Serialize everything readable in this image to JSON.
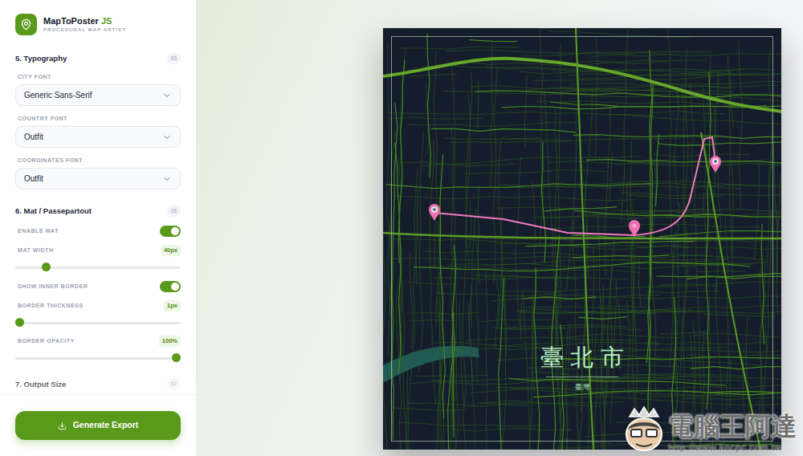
{
  "app": {
    "name": "MapToPoster",
    "accent": "JS",
    "subtitle": "PROCEDURAL MAP ARTIST"
  },
  "sections": [
    {
      "title": "5. Typography",
      "number": "05",
      "controls": [
        {
          "kind": "select",
          "label": "CITY FONT",
          "value": "Generic Sans-Serif"
        },
        {
          "kind": "select",
          "label": "COUNTRY FONT",
          "value": "Outfit"
        },
        {
          "kind": "select",
          "label": "COORDINATES FONT",
          "value": "Outfit"
        }
      ]
    },
    {
      "title": "6. Mat / Passepartout",
      "number": "06",
      "controls": [
        {
          "kind": "toggle",
          "label": "ENABLE MAT",
          "on": true
        },
        {
          "kind": "slider",
          "label": "MAT WIDTH",
          "reading": "40px",
          "level": 0.17
        },
        {
          "kind": "toggle",
          "label": "SHOW INNER BORDER",
          "on": true
        },
        {
          "kind": "slider",
          "label": "BORDER THICKNESS",
          "reading": "1px",
          "level": 0
        },
        {
          "kind": "slider",
          "label": "BORDER OPACITY",
          "reading": "100%",
          "level": 1
        }
      ]
    },
    {
      "title": "7. Output Size",
      "number": "07",
      "controls": []
    }
  ],
  "export_button": {
    "label": "Generate Export"
  },
  "poster": {
    "city": "臺北市",
    "country": "臺灣"
  },
  "watermark": {
    "title": "電腦王阿達",
    "url": "http://www.kocpc.com.tw"
  }
}
